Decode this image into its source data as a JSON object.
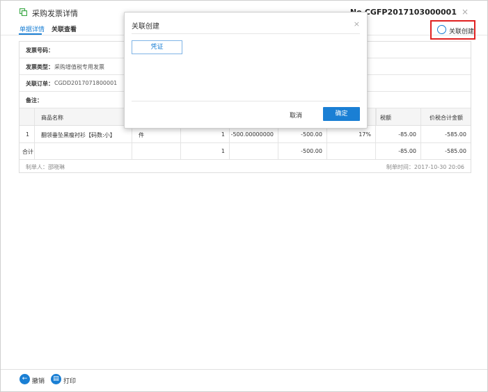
{
  "header": {
    "title": "采购发票详情",
    "number": "No.CGFP2017103000001",
    "close": "×",
    "tabs": [
      "单据详情",
      "关联查看"
    ],
    "link_create": "关联创建"
  },
  "fields": [
    {
      "key": "发票号码：",
      "value": ""
    },
    {
      "key": "发票类型：",
      "value": "采购增值税专用发票"
    },
    {
      "key": "关联订单：",
      "value": "CGDD2017071800001"
    },
    {
      "key": "备注：",
      "value": ""
    }
  ],
  "table": {
    "headers": [
      "",
      "商品名称",
      "",
      "",
      "",
      "",
      "",
      "",
      "税额",
      "价税合计金额"
    ],
    "rows": [
      [
        "1",
        "翻领垂坠黑瘦衬衫【码数:小】",
        "件",
        "1",
        "-500.00000000",
        "-500.00",
        "17%",
        "-85.00",
        "-585.00"
      ]
    ],
    "total": [
      "合计",
      "",
      "",
      "1",
      "",
      "-500.00",
      "",
      "-85.00",
      "-585.00"
    ]
  },
  "footer": {
    "maker": "制单人：邵晓琳",
    "time": "制单时间：2017-10-30 20:06"
  },
  "modal": {
    "title": "关联创建",
    "close": "×",
    "voucher": "凭证",
    "cancel": "取消",
    "confirm": "确定"
  },
  "bottom": {
    "undo": "撤销",
    "print": "打印"
  },
  "colors": {
    "accent": "#1a7fd4",
    "highlight": "#e02020"
  }
}
